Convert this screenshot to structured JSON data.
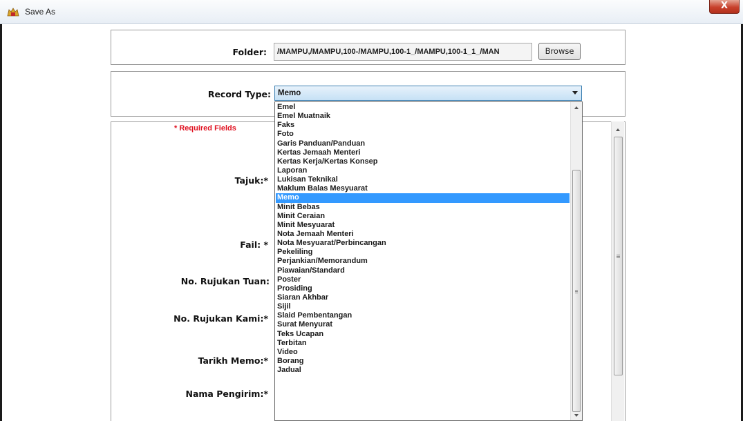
{
  "window": {
    "title": "Save As",
    "close_glyph": "X",
    "app_icon": "crest-icon"
  },
  "folder": {
    "label": "Folder:",
    "path": "/MAMPU,/MAMPU,100-/MAMPU,100-1_/MAMPU,100-1_1_/MAN",
    "browse_label": "Browse"
  },
  "record_type": {
    "label": "Record Type:",
    "value": "Memo"
  },
  "form": {
    "required_note": "* Required Fields",
    "fields": [
      {
        "label": "Tajuk:*"
      },
      {
        "label": "Fail: *"
      },
      {
        "label": "No. Rujukan Tuan:"
      },
      {
        "label": "No. Rujukan Kami:*"
      },
      {
        "label": "Tarikh Memo:*"
      },
      {
        "label": "Nama Pengirim:*"
      }
    ]
  },
  "dropdown": {
    "selected": "Memo",
    "options": [
      "Emel",
      "Emel Muatnaik",
      "Faks",
      "Foto",
      "Garis Panduan/Panduan",
      "Kertas Jemaah Menteri",
      "Kertas Kerja/Kertas Konsep",
      "Laporan",
      "Lukisan Teknikal",
      "Maklum Balas Mesyuarat",
      "Memo",
      "Minit Bebas",
      "Minit Ceraian",
      "Minit Mesyuarat",
      "Nota Jemaah Menteri",
      "Nota Mesyuarat/Perbincangan",
      "Pekeliling",
      "Perjankian/Memorandum",
      "Piawaian/Standard",
      "Poster",
      "Prosiding",
      "Siaran Akhbar",
      "Sijil",
      "Slaid Pembentangan",
      "Surat Menyurat",
      "Teks Ucapan",
      "Terbitan",
      "Video",
      "Borang",
      "Jadual"
    ]
  },
  "colors": {
    "selection": "#3399ff",
    "required": "#e0101f",
    "close_button": "#c8412c"
  }
}
